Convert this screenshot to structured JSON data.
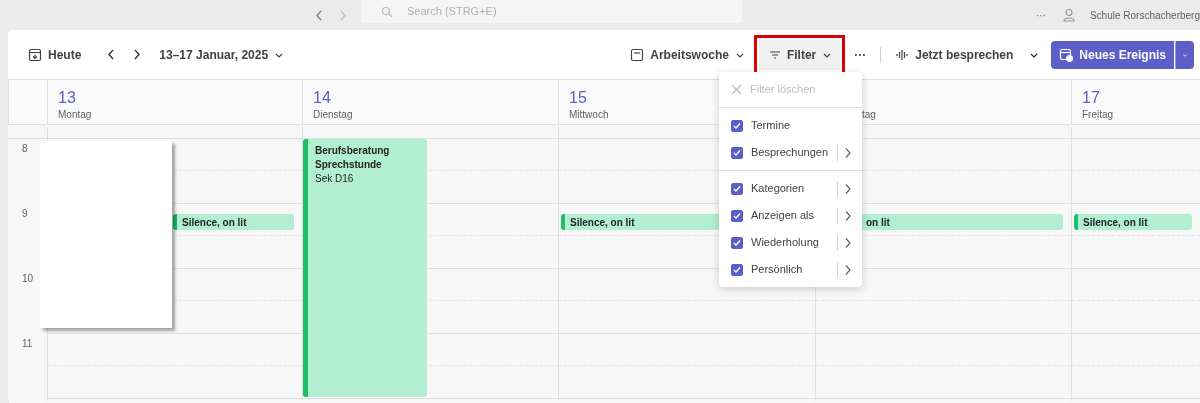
{
  "top_bar": {
    "search": {
      "placeholder": "Search (STRG+E)"
    },
    "more": "···",
    "org_name": "Schule Rorschacherberg"
  },
  "toolbar": {
    "today": "Heute",
    "date_range": "13–17 Januar, 2025",
    "view": "Arbeitswoche",
    "filter": {
      "label": "Filter",
      "highlighted": true
    },
    "more": "···",
    "meet_now": "Jetzt besprechen",
    "new_event": "Neues Ereignis"
  },
  "days": [
    {
      "number": "13",
      "name": "Montag",
      "events": [
        {
          "kind": "bar",
          "title": "Silence, on lit"
        }
      ]
    },
    {
      "number": "14",
      "name": "Dienstag",
      "events": [
        {
          "kind": "block",
          "title": "Berufsberatung Sprechstunde",
          "location": "Sek D16"
        }
      ]
    },
    {
      "number": "15",
      "name": "Mittwoch",
      "events": [
        {
          "kind": "bar",
          "title": "Silence, on lit"
        }
      ]
    },
    {
      "name": "tag",
      "events": [
        {
          "kind": "bar",
          "title": "on lit"
        }
      ]
    },
    {
      "number": "17",
      "name": "Freitag",
      "events": [
        {
          "kind": "bar",
          "title": "Silence, on lit"
        }
      ]
    }
  ],
  "hours": [
    "8",
    "9",
    "10",
    "11"
  ],
  "blank_card": {
    "visible": true
  },
  "filter_menu": {
    "open": true,
    "clear": {
      "label": "Filter löschen",
      "disabled": true
    },
    "groups": [
      [
        {
          "label": "Termine",
          "checked": true,
          "submenu": false
        },
        {
          "label": "Besprechungen",
          "checked": true,
          "submenu": true
        }
      ],
      [
        {
          "label": "Kategorien",
          "checked": true,
          "submenu": true
        },
        {
          "label": "Anzeigen als",
          "checked": true,
          "submenu": true
        },
        {
          "label": "Wiederholung",
          "checked": true,
          "submenu": true
        },
        {
          "label": "Persönlich",
          "checked": true,
          "submenu": true
        }
      ]
    ]
  }
}
